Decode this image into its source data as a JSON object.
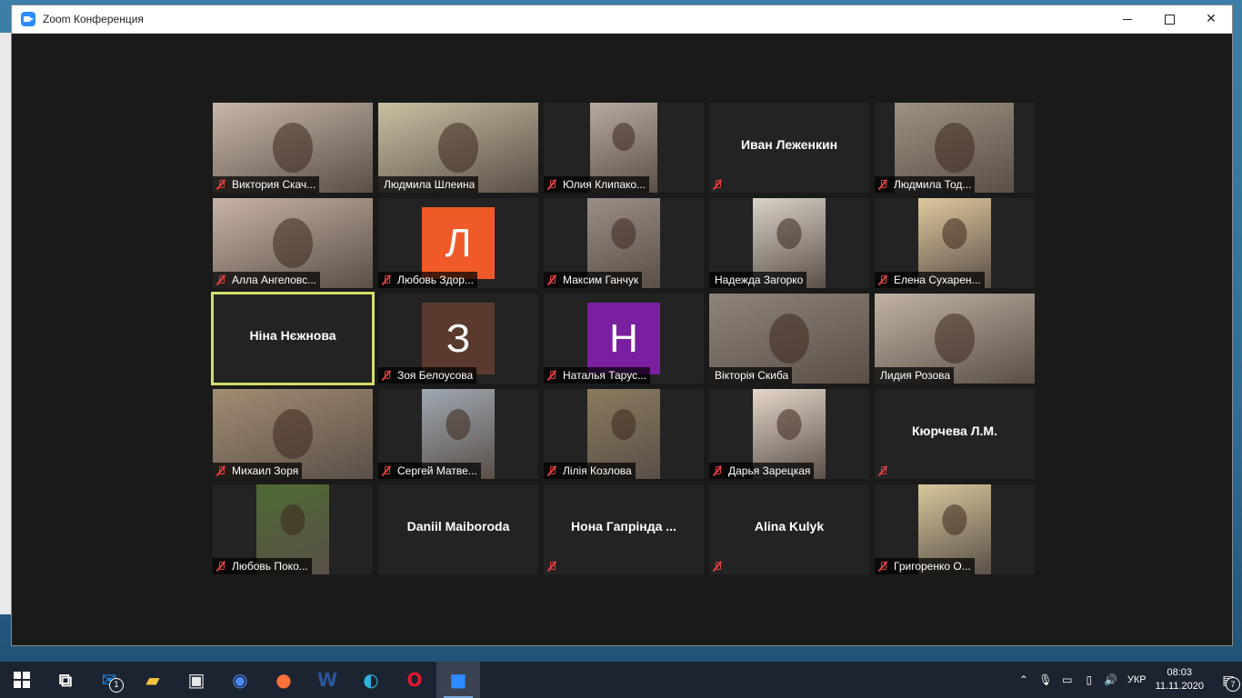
{
  "window": {
    "title": "Zoom Конференция",
    "close_glyph": "✕"
  },
  "tiles": [
    {
      "name": "Виктория Скач...",
      "type": "video",
      "muted": true,
      "bg": "#c8b7a8",
      "pl": 0,
      "pw": 176
    },
    {
      "name": "Людмила Шлеина",
      "type": "video",
      "muted": false,
      "bg": "#c9c0a2",
      "pl": 0,
      "pw": 176
    },
    {
      "name": "Юлия Клипако...",
      "type": "video",
      "muted": true,
      "bg": "#b9aaa0",
      "pl": 51,
      "pw": 74
    },
    {
      "name": "",
      "type": "text",
      "center": "Иван Леженкин",
      "muted": true
    },
    {
      "name": "Людмила Тод...",
      "type": "video",
      "muted": true,
      "bg": "#9e9181",
      "pl": 22,
      "pw": 131
    },
    {
      "name": "Алла Ангеловс...",
      "type": "video",
      "muted": true,
      "bg": "#c8b3a4",
      "pl": 0,
      "pw": 176
    },
    {
      "name": "Любовь Здор...",
      "type": "letter",
      "letter": "Л",
      "color": "#f05a28",
      "muted": true
    },
    {
      "name": "Максим Ганчук",
      "type": "video",
      "muted": true,
      "bg": "#9a8e86",
      "pl": 48,
      "pw": 80
    },
    {
      "name": "Надежда Загорко",
      "type": "video",
      "muted": false,
      "bg": "#d9d2c8",
      "pl": 48,
      "pw": 80
    },
    {
      "name": "Елена Сухарен...",
      "type": "video",
      "muted": true,
      "bg": "#e0c89e",
      "pl": 48,
      "pw": 80
    },
    {
      "name": "",
      "type": "text",
      "center": "Ніна Нєжнова",
      "muted": false,
      "active": true
    },
    {
      "name": "Зоя Белоусова",
      "type": "letter",
      "letter": "З",
      "color": "#5a3a2e",
      "muted": true
    },
    {
      "name": "Наталья Тарус...",
      "type": "letter",
      "letter": "Н",
      "color": "#7a1fa0",
      "muted": true
    },
    {
      "name": "Вікторія Скиба",
      "type": "video",
      "muted": false,
      "bg": "#8e8479",
      "pl": 0,
      "pw": 176
    },
    {
      "name": "Лидия Розова",
      "type": "video",
      "muted": false,
      "bg": "#c2b3a3",
      "pl": 0,
      "pw": 176
    },
    {
      "name": "Михаил Зоря",
      "type": "video",
      "muted": true,
      "bg": "#a28c72",
      "pl": 0,
      "pw": 176
    },
    {
      "name": "Сергей Матве...",
      "type": "video",
      "muted": true,
      "bg": "#9fa8b3",
      "pl": 48,
      "pw": 80
    },
    {
      "name": "Лілія Козлова",
      "type": "video",
      "muted": true,
      "bg": "#8a7a5e",
      "pl": 48,
      "pw": 80
    },
    {
      "name": "Дарья Зарецкая",
      "type": "video",
      "muted": true,
      "bg": "#e6d6c9",
      "pl": 48,
      "pw": 80
    },
    {
      "name": "",
      "type": "text",
      "center": "Кюрчева Л.М.",
      "muted": true
    },
    {
      "name": "Любовь Поко...",
      "type": "video",
      "muted": true,
      "bg": "#4d6a34",
      "pl": 48,
      "pw": 80
    },
    {
      "name": "",
      "type": "text",
      "center": "Daniil Maiboroda",
      "muted": false
    },
    {
      "name": "",
      "type": "text",
      "center": "Нона  Гапрінда ...",
      "muted": true
    },
    {
      "name": "",
      "type": "text",
      "center": "Alina Kulyk",
      "muted": true
    },
    {
      "name": "Григоренко О...",
      "type": "video",
      "muted": true,
      "bg": "#d7c79c",
      "pl": 48,
      "pw": 80
    }
  ],
  "taskbar": {
    "items": [
      {
        "name": "task-view-icon",
        "glyph": "⧉",
        "color": "#ffffff"
      },
      {
        "name": "mail-icon",
        "glyph": "✉",
        "color": "#1e88e5",
        "badge": "1"
      },
      {
        "name": "file-explorer-icon",
        "glyph": "▰",
        "color": "#f5c542"
      },
      {
        "name": "store-icon",
        "glyph": "▣",
        "color": "#e8e8e8"
      },
      {
        "name": "chrome-icon",
        "glyph": "◉",
        "color": "#4c8bf5"
      },
      {
        "name": "firefox-icon",
        "glyph": "●",
        "color": "#ff7139"
      },
      {
        "name": "word-icon",
        "glyph": "W",
        "color": "#2b579a"
      },
      {
        "name": "edge-icon",
        "glyph": "◐",
        "color": "#30b3d9"
      },
      {
        "name": "opera-icon",
        "glyph": "O",
        "color": "#e3192c"
      },
      {
        "name": "zoom-icon",
        "glyph": "■",
        "color": "#2d8cff",
        "active": true
      }
    ],
    "lang": "УКР",
    "time": "08:03",
    "date": "11.11.2020",
    "notif_count": "7"
  }
}
